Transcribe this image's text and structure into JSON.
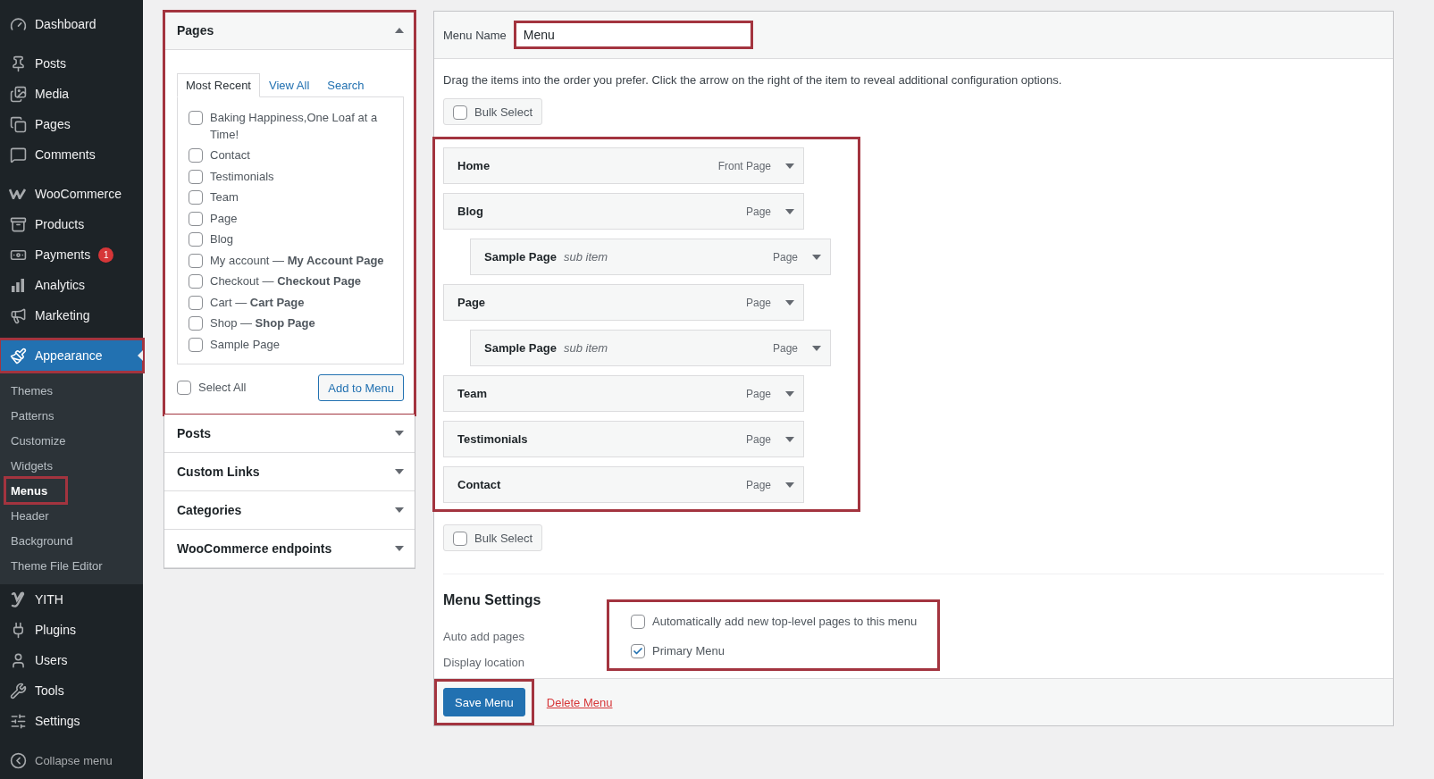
{
  "sidebar": {
    "groups": [
      {
        "items": [
          {
            "label": "Dashboard",
            "selected": false,
            "highlighted": false
          }
        ]
      },
      {
        "items": [
          {
            "label": "Posts",
            "selected": false,
            "highlighted": false
          },
          {
            "label": "Media",
            "selected": false,
            "highlighted": false
          },
          {
            "label": "Pages",
            "selected": false,
            "highlighted": false
          },
          {
            "label": "Comments",
            "selected": false,
            "highlighted": false
          }
        ]
      },
      {
        "items": [
          {
            "label": "WooCommerce",
            "selected": false,
            "highlighted": false
          },
          {
            "label": "Products",
            "selected": false,
            "highlighted": false
          },
          {
            "label": "Payments",
            "badge": "1",
            "selected": false,
            "highlighted": false
          },
          {
            "label": "Analytics",
            "selected": false,
            "highlighted": false
          },
          {
            "label": "Marketing",
            "selected": false,
            "highlighted": false
          }
        ]
      },
      {
        "items": [
          {
            "label": "Appearance",
            "selected": true,
            "highlighted": true,
            "children": [
              {
                "label": "Themes",
                "selected": false,
                "highlighted": false
              },
              {
                "label": "Patterns",
                "selected": false,
                "highlighted": false
              },
              {
                "label": "Customize",
                "selected": false,
                "highlighted": false
              },
              {
                "label": "Widgets",
                "selected": false,
                "highlighted": false
              },
              {
                "label": "Menus",
                "selected": true,
                "highlighted": true
              },
              {
                "label": "Header",
                "selected": false,
                "highlighted": false
              },
              {
                "label": "Background",
                "selected": false,
                "highlighted": false
              },
              {
                "label": "Theme File Editor",
                "selected": false,
                "highlighted": false
              }
            ]
          },
          {
            "label": "YITH",
            "selected": false,
            "highlighted": false
          },
          {
            "label": "Plugins",
            "selected": false,
            "highlighted": false
          },
          {
            "label": "Users",
            "selected": false,
            "highlighted": false
          },
          {
            "label": "Tools",
            "selected": false,
            "highlighted": false
          },
          {
            "label": "Settings",
            "selected": false,
            "highlighted": false
          }
        ]
      }
    ],
    "collapse": "Collapse menu"
  },
  "add_items": {
    "sections": [
      {
        "title": "Pages",
        "expanded": true,
        "highlighted": true,
        "tabs": [
          {
            "label": "Most Recent",
            "selected": true
          },
          {
            "label": "View All",
            "selected": false
          },
          {
            "label": "Search",
            "selected": false
          }
        ],
        "items": [
          {
            "label": "Baking Happiness,One Loaf at a Time!",
            "checked": false
          },
          {
            "label": "Contact",
            "checked": false
          },
          {
            "label": "Testimonials",
            "checked": false
          },
          {
            "label": "Team",
            "checked": false
          },
          {
            "label": "Page",
            "checked": false
          },
          {
            "label": "Blog",
            "checked": false
          },
          {
            "label": "My account — **My Account Page**",
            "checked": false
          },
          {
            "label": "Checkout — **Checkout Page**",
            "checked": false
          },
          {
            "label": "Cart — **Cart Page**",
            "checked": false
          },
          {
            "label": "Shop — **Shop Page**",
            "checked": false
          },
          {
            "label": "Sample Page",
            "checked": false
          }
        ],
        "select_all": {
          "label": "Select All",
          "checked": false
        },
        "add_button": "Add to Menu"
      },
      {
        "title": "Posts",
        "expanded": false,
        "highlighted": false
      },
      {
        "title": "Custom Links",
        "expanded": false,
        "highlighted": false
      },
      {
        "title": "Categories",
        "expanded": false,
        "highlighted": false
      },
      {
        "title": "WooCommerce endpoints",
        "expanded": false,
        "highlighted": false
      }
    ]
  },
  "menu_editor": {
    "menu_name": {
      "label": "Menu Name",
      "value": "Menu",
      "highlighted": true
    },
    "instructions": "Drag the items into the order you prefer. Click the arrow on the right of the item to reveal additional configuration options.",
    "bulk_select_top": {
      "label": "Bulk Select",
      "checked": false
    },
    "structure_highlighted": true,
    "items": [
      {
        "title": "Home",
        "type": "Front Page"
      },
      {
        "title": "Blog",
        "type": "Page",
        "children": [
          {
            "title": "Sample Page",
            "note": "sub item",
            "type": "Page"
          }
        ]
      },
      {
        "title": "Page",
        "type": "Page",
        "children": [
          {
            "title": "Sample Page",
            "note": "sub item",
            "type": "Page"
          }
        ]
      },
      {
        "title": "Team",
        "type": "Page"
      },
      {
        "title": "Testimonials",
        "type": "Page"
      },
      {
        "title": "Contact",
        "type": "Page"
      }
    ],
    "bulk_select_bottom": {
      "label": "Bulk Select",
      "checked": false
    },
    "settings": {
      "title": "Menu Settings",
      "highlighted": true,
      "rows": [
        {
          "label": "Auto add pages",
          "option": "Automatically add new top-level pages to this menu",
          "checked": false
        },
        {
          "label": "Display location",
          "option": "Primary Menu",
          "checked": true
        }
      ]
    },
    "save_button": {
      "label": "Save Menu",
      "highlighted": true
    },
    "delete_link": "Delete Menu"
  }
}
